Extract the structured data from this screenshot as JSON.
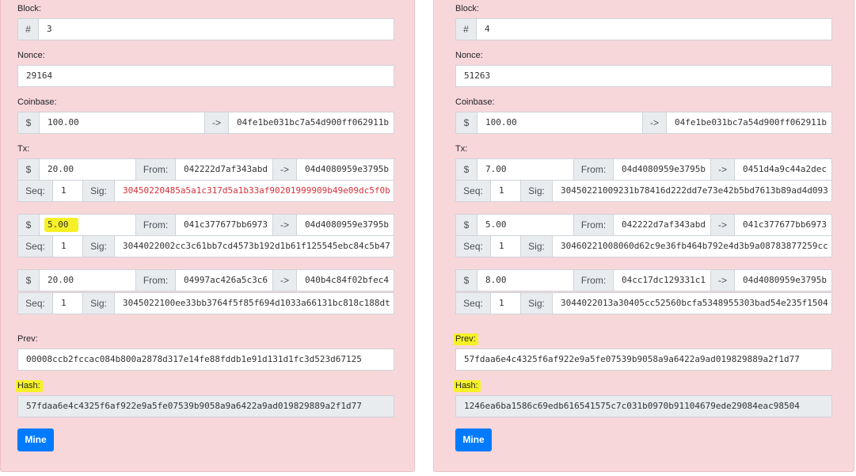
{
  "labels": {
    "block": "Block:",
    "nonce": "Nonce:",
    "coinbase": "Coinbase:",
    "tx": "Tx:",
    "prev": "Prev:",
    "hash": "Hash:"
  },
  "symbols": {
    "hash_sign": "#",
    "dollar": "$",
    "arrow": "->",
    "from": "From:",
    "seq": "Seq:",
    "sig": "Sig:"
  },
  "button_label": "Mine",
  "highlight_color": "#f6f126",
  "blocks": [
    {
      "block": "3",
      "nonce": "29164",
      "coinbase": {
        "amount": "100.00",
        "to": "04fe1be031bc7a54d900ff062911b"
      },
      "txs": [
        {
          "amount": "20.00",
          "from": "042222d7af343abd",
          "to": "04d4080959e3795b",
          "seq": "1",
          "sig": "30450220485a5a1c317d5a1b33af90201999909b49e09dc5f0b"
        },
        {
          "amount": "5.00",
          "from": "041c377677bb6973",
          "to": "04d4080959e3795b",
          "seq": "1",
          "sig": "3044022002cc3c61bb7cd4573b192d1b61f125545ebc84c5b47"
        },
        {
          "amount": "20.00",
          "from": "04997ac426a5c3c6",
          "to": "040b4c84f02bfec4",
          "seq": "1",
          "sig": "3045022100ee33bb3764f5f85f694d1033a66131bc818c188dt"
        }
      ],
      "prev": "00008ccb2fccac084b800a2878d317e14fe88fddb1e91d131d1fc3d523d67125",
      "hash": "57fdaa6e4c4325f6af922e9a5fe07539b9058a9a6422a9ad019829889a2f1d77"
    },
    {
      "block": "4",
      "nonce": "51263",
      "coinbase": {
        "amount": "100.00",
        "to": "04fe1be031bc7a54d900ff062911b"
      },
      "txs": [
        {
          "amount": "7.00",
          "from": "04d4080959e3795b",
          "to": "0451d4a9c44a2dec",
          "seq": "1",
          "sig": "30450221009231b78416d222dd7e73e42b5bd7613b89ad4d093"
        },
        {
          "amount": "5.00",
          "from": "042222d7af343abd",
          "to": "041c377677bb6973",
          "seq": "1",
          "sig": "30460221008060d62c9e36fb464b792e4d3b9a08783877259cc"
        },
        {
          "amount": "8.00",
          "from": "04cc17dc129331c1",
          "to": "04d4080959e3795b",
          "seq": "1",
          "sig": "3044022013a30405cc52560bcfa5348955303bad54e235f1504"
        }
      ],
      "prev": "57fdaa6e4c4325f6af922e9a5fe07539b9058a9a6422a9ad019829889a2f1d77",
      "hash": "1246ea6ba1586c69edb616541575c7c031b0970b91104679ede29084eac98504"
    }
  ]
}
